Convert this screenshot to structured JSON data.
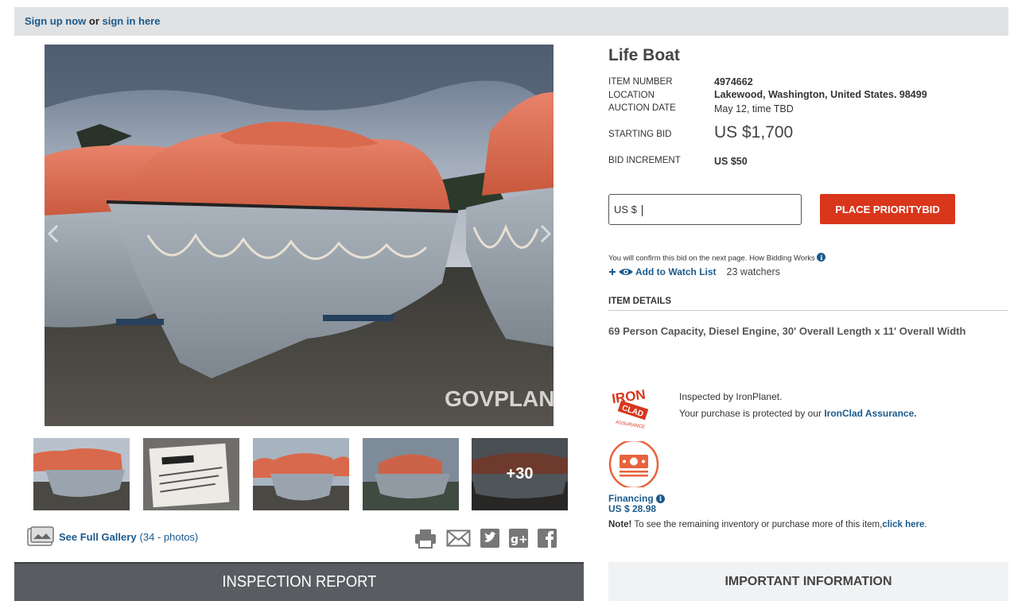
{
  "topbar": {
    "signup": "Sign up now",
    "or": "or",
    "signin": "sign in here"
  },
  "photo": {
    "watermark": "GOVPLANET",
    "more_count": "+30"
  },
  "gallery": {
    "label": "See Full Gallery",
    "count": "(34 - photos)"
  },
  "share_icons": [
    "print-icon",
    "email-icon",
    "twitter-icon",
    "google-plus-icon",
    "facebook-icon"
  ],
  "inspection_button": "INSPECTION REPORT",
  "item": {
    "title": "Life Boat",
    "number_label": "ITEM NUMBER",
    "number": "4974662",
    "location_label": "LOCATION",
    "location": "Lakewood, Washington, United States. 98499",
    "date_label": "AUCTION DATE",
    "date": "May 12, time TBD",
    "starting_bid_label": "STARTING BID",
    "starting_bid": "US $1,700",
    "increment_label": "BID INCREMENT",
    "increment": "US $50"
  },
  "bid": {
    "input_prefix": "US $",
    "button": "PLACE PRIORITYBID",
    "confirm_text": "You will confirm this bid on the next page. How Bidding Works",
    "watch_label": "Add to Watch List",
    "watchers": "23 watchers"
  },
  "details": {
    "heading": "ITEM DETAILS",
    "text": "69 Person Capacity, Diesel Engine, 30' Overall Length x 11' Overall Width"
  },
  "ironclad": {
    "logo_text": "IRON CLAD ASSURANCE",
    "line1": "Inspected by IronPlanet.",
    "line2_prefix": "Your purchase is protected by our",
    "line2_link": "IronClad Assurance."
  },
  "financing": {
    "label": "Financing",
    "amount": "US $ 28.98"
  },
  "note": {
    "bold": "Note!",
    "text": "To see the remaining inventory or purchase more of this item,",
    "link": "click here",
    "end": "."
  },
  "important_button": "IMPORTANT INFORMATION",
  "colors": {
    "link": "#1b5a8c",
    "cta": "#d9361c",
    "topbar": "#e1e2e3",
    "inspection_bg": "#595c60"
  }
}
